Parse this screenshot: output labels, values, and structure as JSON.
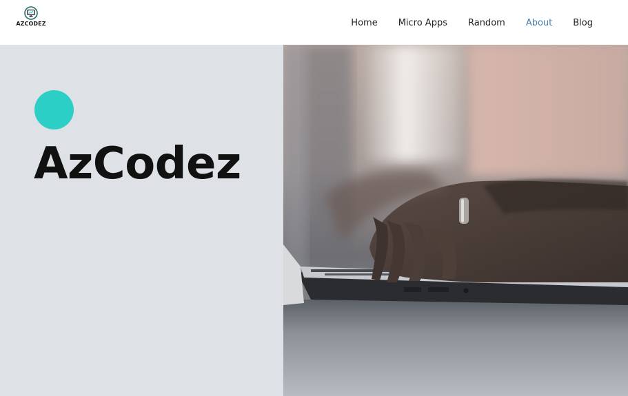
{
  "brand": {
    "logo_text": "AZCODEZ",
    "accent": "#2ccfc5",
    "logo_color": "#1f6e66"
  },
  "nav": {
    "items": [
      {
        "label": "Home",
        "active": false
      },
      {
        "label": "Micro Apps",
        "active": false
      },
      {
        "label": "Random",
        "active": false
      },
      {
        "label": "About",
        "active": true
      },
      {
        "label": "Blog",
        "active": false
      }
    ],
    "active_color": "#4a7eab"
  },
  "hero": {
    "title": "AzCodez",
    "background": "#dee1e5",
    "image": "hands-typing-on-laptop-photo"
  }
}
